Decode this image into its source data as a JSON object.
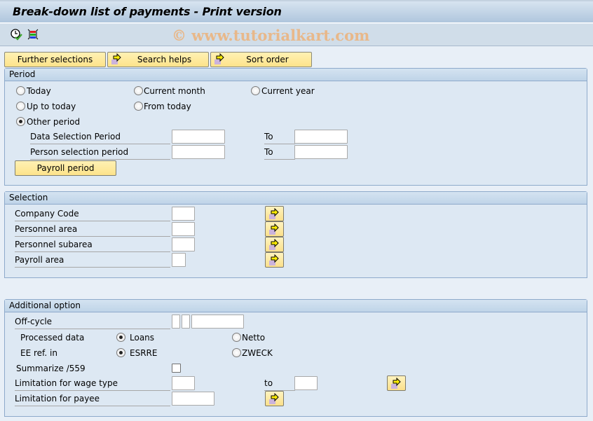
{
  "window": {
    "title": "Break-down list of payments - Print version"
  },
  "toolbar": {
    "icons": [
      "execute-clock-icon",
      "selection-options-icon"
    ],
    "watermark": "© www.tutorialkart.com"
  },
  "tabs": [
    {
      "label": "Further selections",
      "icon": null
    },
    {
      "label": "Search helps",
      "icon": "multiple-selection-arrow-icon"
    },
    {
      "label": "Sort order",
      "icon": "multiple-selection-arrow-icon"
    }
  ],
  "period": {
    "title": "Period",
    "radios": [
      {
        "label": "Today",
        "selected": false
      },
      {
        "label": "Current month",
        "selected": false
      },
      {
        "label": "Current year",
        "selected": false
      },
      {
        "label": "Up to today",
        "selected": false
      },
      {
        "label": "From today",
        "selected": false
      },
      {
        "label": "Other period",
        "selected": true
      }
    ],
    "fields": [
      {
        "label": "Data Selection Period",
        "from": "",
        "to_label": "To",
        "to": ""
      },
      {
        "label": "Person selection period",
        "from": "",
        "to_label": "To",
        "to": ""
      }
    ],
    "payroll_button": "Payroll period"
  },
  "selection": {
    "title": "Selection",
    "fields": [
      {
        "label": "Company Code",
        "value": ""
      },
      {
        "label": "Personnel area",
        "value": ""
      },
      {
        "label": "Personnel subarea",
        "value": ""
      },
      {
        "label": "Payroll area",
        "value": ""
      }
    ]
  },
  "additional": {
    "title": "Additional option",
    "offcycle": {
      "label": "Off-cycle",
      "values": [
        "",
        "",
        ""
      ]
    },
    "processed_data": {
      "label": "Processed data",
      "options": [
        {
          "label": "Loans",
          "selected": true
        },
        {
          "label": "Netto",
          "selected": false
        }
      ]
    },
    "ee_ref": {
      "label": "EE ref. in",
      "options": [
        {
          "label": "ESRRE",
          "selected": true
        },
        {
          "label": "ZWECK",
          "selected": false
        }
      ]
    },
    "summarize": {
      "label": "Summarize /559",
      "checked": false
    },
    "wage_type": {
      "label": "Limitation for wage type",
      "from": "",
      "to_label": "to",
      "to": ""
    },
    "payee": {
      "label": "Limitation for payee",
      "value": ""
    }
  },
  "colors": {
    "button_yellow": "#fde38a",
    "group_bg": "#dde8f3",
    "header_bg": "#bfd4e8",
    "watermark": "#e8b88a"
  }
}
